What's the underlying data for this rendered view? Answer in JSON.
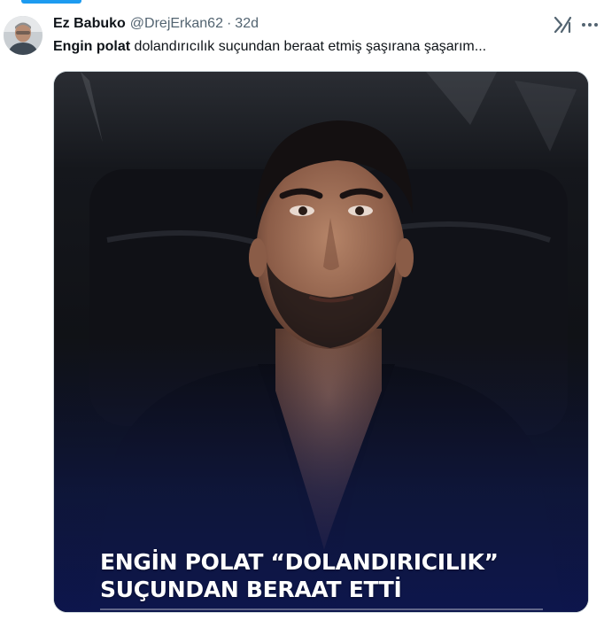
{
  "tweet": {
    "author_name": "Ez Babuko",
    "handle": "@DrejErkan62",
    "separator": "·",
    "time": "32d",
    "text_bold": "Engin polat",
    "text_rest": " dolandırıcılık suçundan beraat etmiş şaşırana şaşarım...",
    "avatar_icon": "user-avatar",
    "grok_icon": "grok-icon",
    "more_icon": "more-icon"
  },
  "media": {
    "headline_line1": "ENGİN POLAT “DOLANDIRICILIK”",
    "headline_line2": "SUÇUNDAN BERAAT ETTİ"
  },
  "colors": {
    "accent": "#1d9bf0",
    "text": "#0f1419",
    "secondary": "#536471",
    "overlay": "#0f1845"
  }
}
